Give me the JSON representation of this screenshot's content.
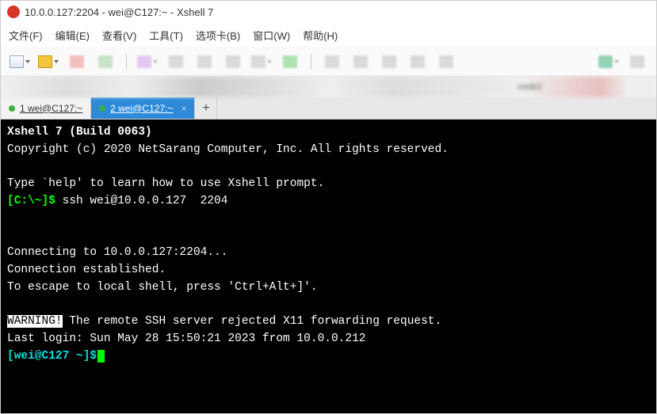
{
  "window": {
    "title": "10.0.0.127:2204 - wei@C127:~ - Xshell 7"
  },
  "menu": {
    "file": "文件(F)",
    "edit": "编辑(E)",
    "view": "查看(V)",
    "tools": "工具(T)",
    "tabs": "选项卡(B)",
    "window": "窗口(W)",
    "help": "帮助(H)"
  },
  "blur": {
    "label": "node2"
  },
  "tabs": {
    "tab1": {
      "label": "1 wei@C127:~"
    },
    "tab2": {
      "label": "2 wei@C127:~"
    },
    "close": "×",
    "add": "+"
  },
  "terminal": {
    "l1": "Xshell 7 (Build 0063)",
    "l2": "Copyright (c) 2020 NetSarang Computer, Inc. All rights reserved.",
    "l3": "",
    "l4": "Type `help' to learn how to use Xshell prompt.",
    "prompt1_a": "[C:\\~]$",
    "prompt1_b": " ssh wei@10.0.0.127  2204",
    "l5": "",
    "l6": "",
    "l7": "Connecting to 10.0.0.127:2204...",
    "l8": "Connection established.",
    "l9": "To escape to local shell, press 'Ctrl+Alt+]'.",
    "l10": "",
    "warn": "WARNING!",
    "warn_rest": " The remote SSH server rejected X11 forwarding request.",
    "l11": "Last login: Sun May 28 15:50:21 2023 from 10.0.0.212",
    "prompt2": "[wei@C127 ~]$"
  }
}
